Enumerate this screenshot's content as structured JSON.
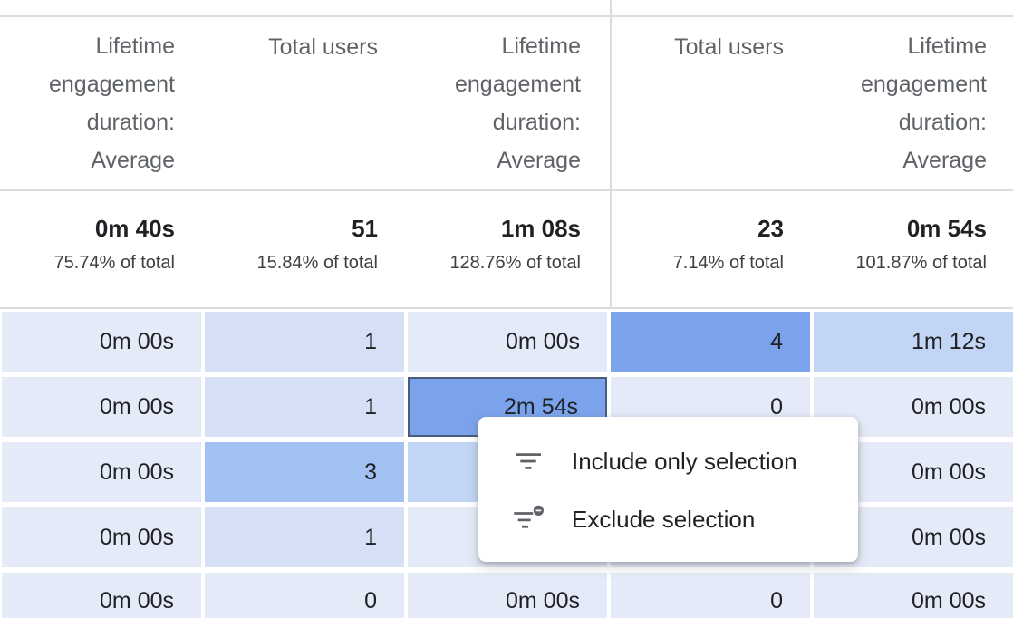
{
  "headers": [
    "Lifetime\nengagement\nduration:\nAverage",
    "Total users",
    "Lifetime\nengagement\nduration:\nAverage",
    "Total users",
    "Lifetime\nengagement\nduration:\nAverage"
  ],
  "totals": [
    {
      "value": "0m 40s",
      "pct": "75.74% of total"
    },
    {
      "value": "51",
      "pct": "15.84% of total"
    },
    {
      "value": "1m 08s",
      "pct": "128.76% of total"
    },
    {
      "value": "23",
      "pct": "7.14% of total"
    },
    {
      "value": "0m 54s",
      "pct": "101.87% of total"
    }
  ],
  "rows": [
    [
      "0m 00s",
      "1",
      "0m 00s",
      "4",
      "1m 12s"
    ],
    [
      "0m 00s",
      "1",
      "2m 54s",
      "0",
      "0m 00s"
    ],
    [
      "0m 00s",
      "3",
      "",
      "",
      "0m 00s"
    ],
    [
      "0m 00s",
      "1",
      "",
      "",
      "0m 00s"
    ],
    [
      "0m 00s",
      "0",
      "0m 00s",
      "0",
      "0m 00s"
    ]
  ],
  "heat_colors": [
    [
      "#e4eaf8",
      "#d5e0f6",
      "#e4eaf8",
      "#7ba3ec",
      "#c3d5f4"
    ],
    [
      "#e4eaf8",
      "#d5e0f6",
      "#7ba3ec",
      "#e4eaf8",
      "#e4eaf8"
    ],
    [
      "#e4eaf8",
      "#a2c0f2",
      "#c3d5f4",
      "#e4eaf8",
      "#e4eaf8"
    ],
    [
      "#e4eaf8",
      "#d5e0f6",
      "#e4eaf8",
      "#e4eaf8",
      "#e4eaf8"
    ],
    [
      "#e4eaf8",
      "#e4eaf8",
      "#e4eaf8",
      "#e4eaf8",
      "#e4eaf8"
    ]
  ],
  "selected_cell": {
    "row": 1,
    "col": 2
  },
  "context_menu": {
    "include_label": "Include only selection",
    "include_icon": "filter-icon",
    "exclude_label": "Exclude selection",
    "exclude_icon": "filter-remove-icon"
  }
}
